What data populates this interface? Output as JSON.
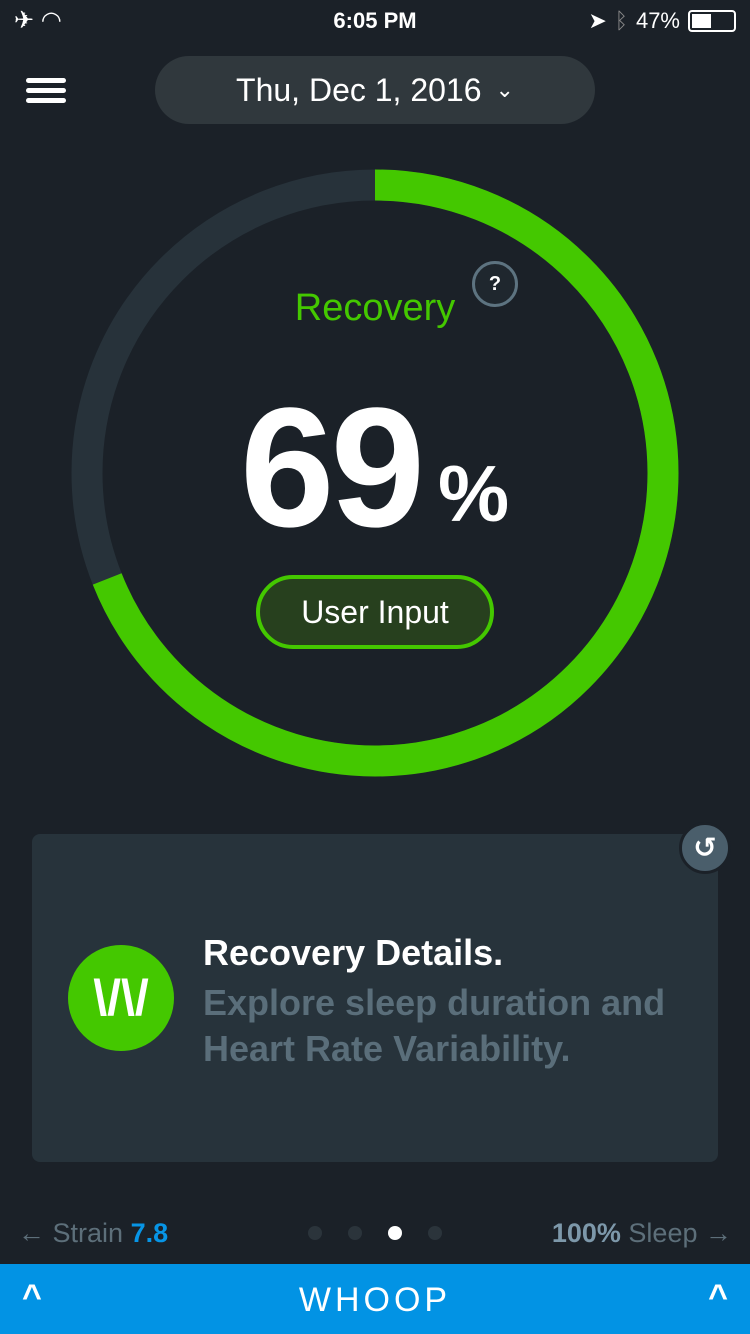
{
  "status_bar": {
    "time": "6:05 PM",
    "battery": "47%",
    "battery_level": 0.47,
    "icons": [
      "airplane-icon",
      "wifi-icon",
      "location-icon",
      "bluetooth-icon",
      "battery-icon"
    ]
  },
  "header": {
    "date": "Thu, Dec 1, 2016"
  },
  "recovery": {
    "label": "Recovery",
    "help": "?",
    "score": "69",
    "unit": "%",
    "value_percent": 69,
    "user_input": "User Input",
    "color": "#44c800"
  },
  "card": {
    "logo": "\\/\\/",
    "title": "Recovery Details.",
    "description": "Explore sleep duration and Heart Rate Variability."
  },
  "nav": {
    "left_arrow": "←",
    "left_label": "Strain",
    "left_value": "7.8",
    "right_value": "100%",
    "right_label": "Sleep",
    "right_arrow": "→",
    "pages": 4,
    "active_page": 3
  },
  "footer": {
    "brand": "WHOOP",
    "color": "#0293e4"
  }
}
